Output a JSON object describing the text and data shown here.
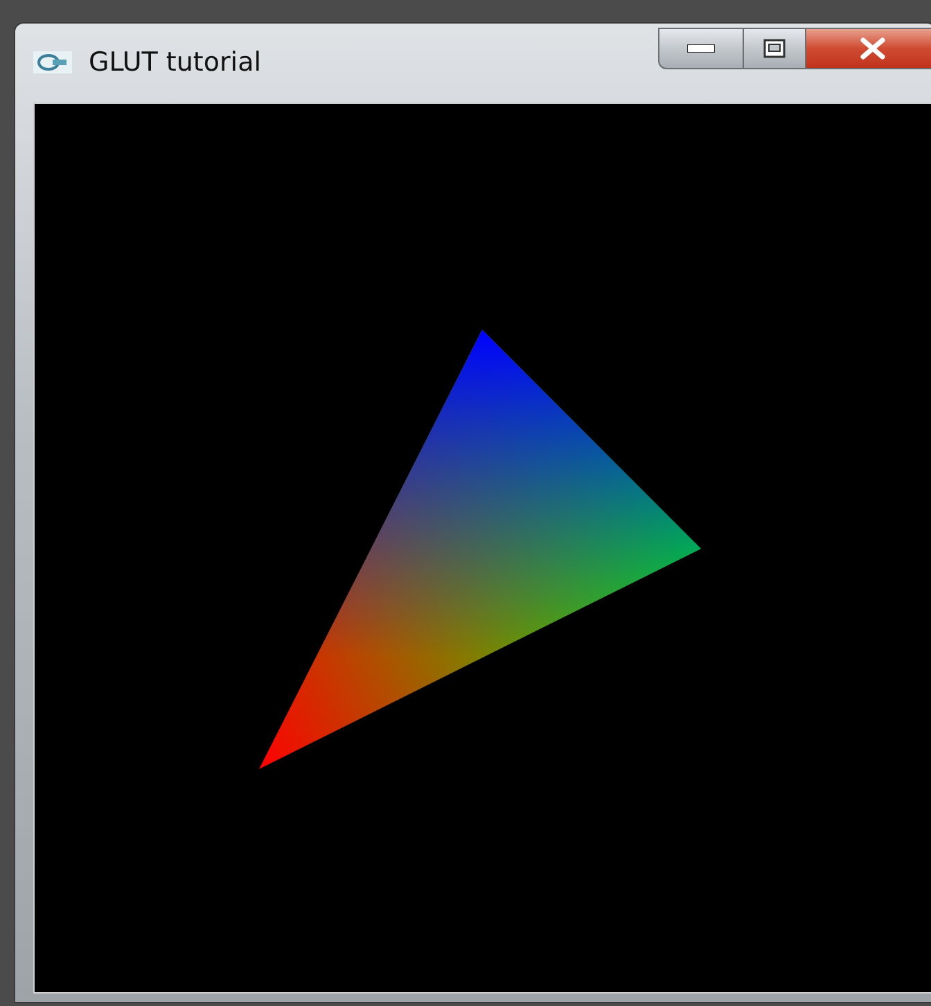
{
  "window": {
    "title": "GLUT tutorial"
  }
}
